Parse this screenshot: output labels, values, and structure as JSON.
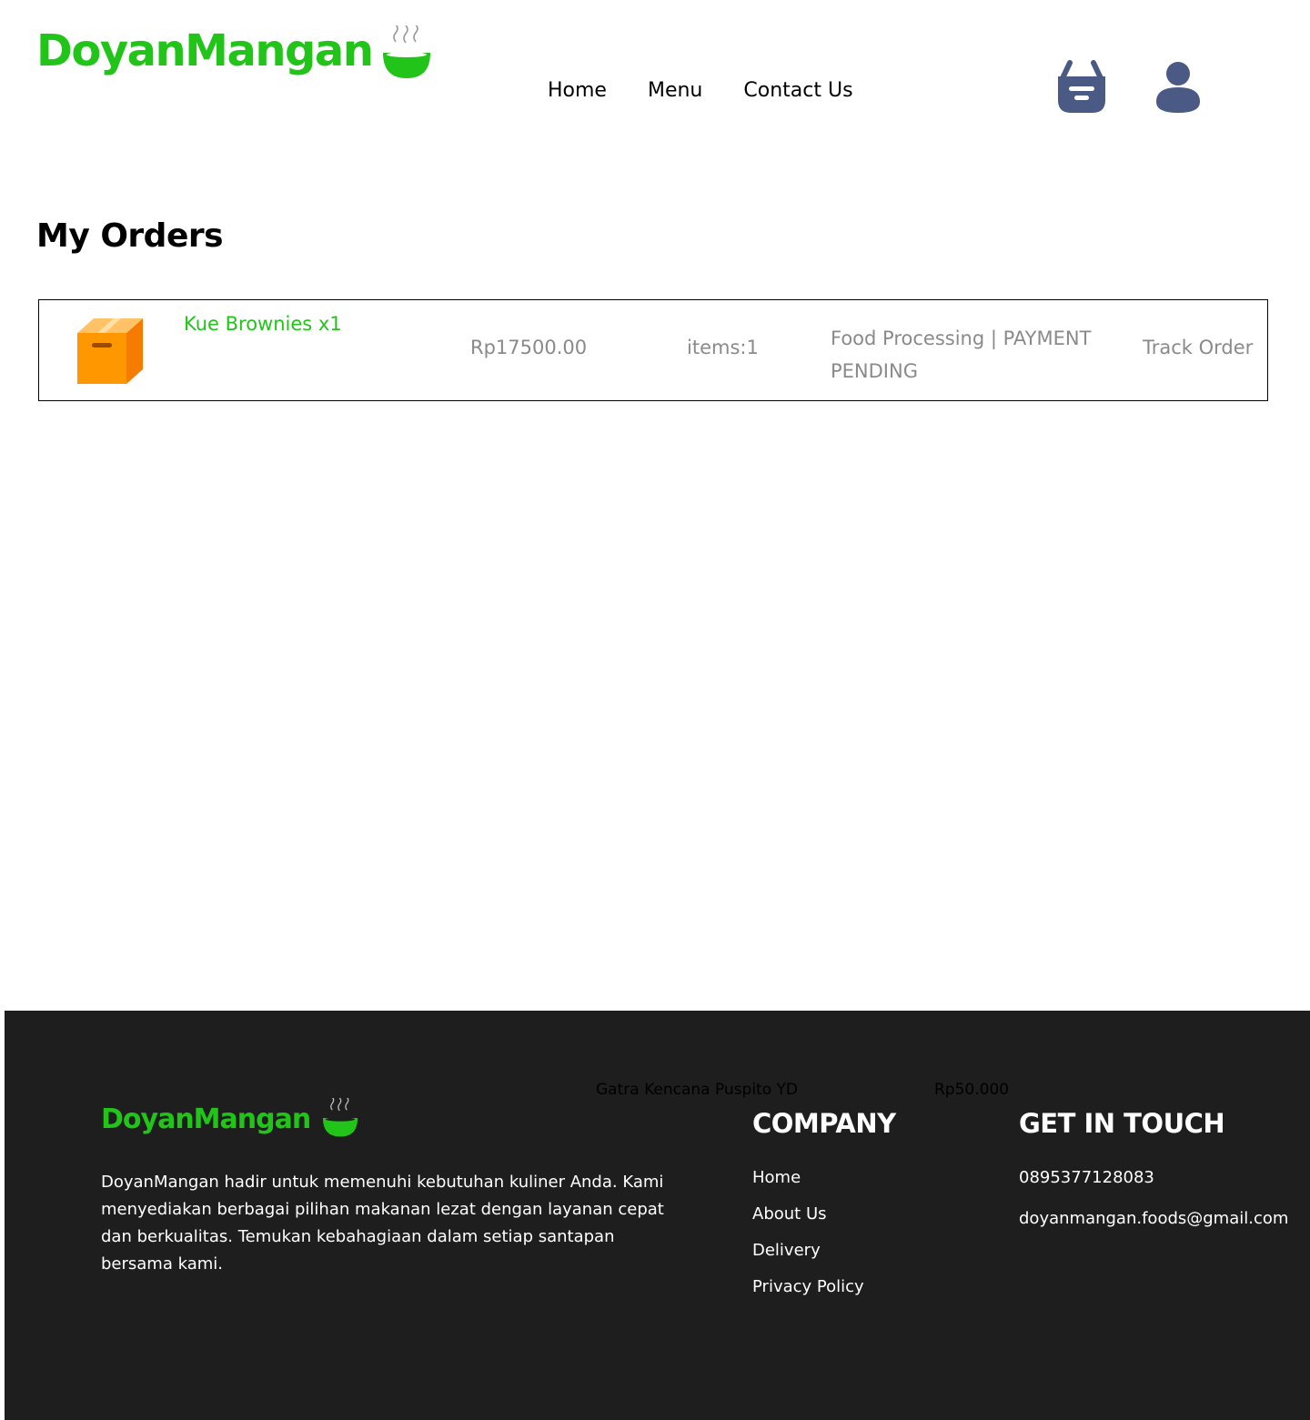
{
  "brand": {
    "name": "DoyanMangan",
    "color": "#22c41a"
  },
  "nav": {
    "items": [
      "Home",
      "Menu",
      "Contact Us"
    ]
  },
  "header_icons": [
    "cart-icon",
    "user-icon"
  ],
  "main": {
    "title": "My Orders",
    "orders": [
      {
        "name": "Kue Brownies x1",
        "price": "Rp17500.00",
        "items": "items:1",
        "status": "Food Processing | PAYMENT PENDING",
        "action": "Track Order",
        "icon": "package-box-icon"
      }
    ]
  },
  "footer": {
    "floating_name": "Gatra Kencana Puspito YD",
    "floating_price": "Rp50.000",
    "logo": "DoyanMangan",
    "description": "DoyanMangan hadir untuk memenuhi kebutuhan kuliner Anda. Kami menyediakan berbagai pilihan makanan lezat dengan layanan cepat dan berkualitas. Temukan kebahagiaan dalam setiap santapan bersama kami.",
    "company_heading": "COMPANY",
    "company_links": [
      "Home",
      "About Us",
      "Delivery",
      "Privacy Policy"
    ],
    "contact_heading": "GET IN TOUCH",
    "phone": "0895377128083",
    "email": "doyanmangan.foods@gmail.com",
    "background": "#1e1e1e"
  }
}
